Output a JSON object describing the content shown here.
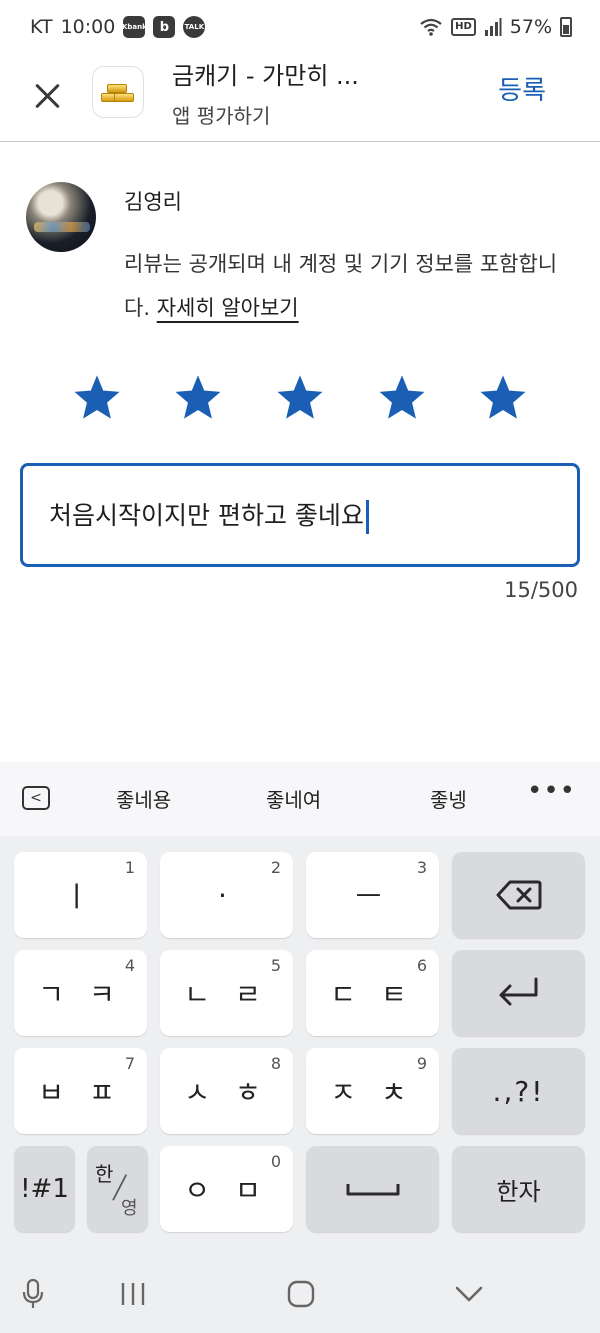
{
  "status_bar": {
    "carrier": "KT",
    "time": "10:00",
    "badges": [
      "Kbank",
      "b",
      "TALK"
    ],
    "hd": "HD",
    "battery": "57%"
  },
  "header": {
    "app_title": "금캐기 - 가만히 ...",
    "subtitle": "앱 평가하기",
    "submit_label": "등록",
    "close_icon": "close-icon",
    "app_icon": "gold-bars-icon"
  },
  "review": {
    "user_name": "김영리",
    "notice_text": "리뷰는 공개되며 내 계정 및 기기 정보를 포함합니다.",
    "learn_more": "자세히 알아보기",
    "rating": 5,
    "max_rating": 5,
    "text": "처음시작이지만 편하고 좋네요",
    "counter": "15/500"
  },
  "colors": {
    "accent": "#1a5fb4",
    "star": "#1a5fb4",
    "keyboard_bg": "#eeeff1"
  },
  "keyboard": {
    "suggestions": [
      "좋네용",
      "좋네여",
      "좋넹"
    ],
    "keys": {
      "k1": {
        "label": "ㅣ",
        "num": "1"
      },
      "k2": {
        "label": "·",
        "num": "2"
      },
      "k3": {
        "label": "ㅡ",
        "num": "3"
      },
      "k4": {
        "label": "ㄱ ㅋ",
        "num": "4"
      },
      "k5": {
        "label": "ㄴ ㄹ",
        "num": "5"
      },
      "k6": {
        "label": "ㄷ ㅌ",
        "num": "6"
      },
      "k7": {
        "label": "ㅂ ㅍ",
        "num": "7"
      },
      "k8": {
        "label": "ㅅ ㅎ",
        "num": "8"
      },
      "k9": {
        "label": "ㅈ ㅊ",
        "num": "9"
      },
      "k0": {
        "label": "ㅇ ㅁ",
        "num": "0"
      },
      "punct": ".,?!",
      "symbols": "!#1",
      "lang_top": "한",
      "lang_bottom": "영",
      "hanja": "한자"
    }
  }
}
